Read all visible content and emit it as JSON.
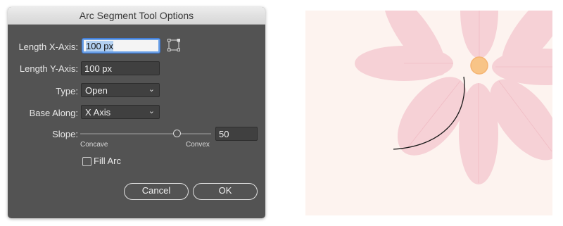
{
  "dialog": {
    "title": "Arc Segment Tool Options",
    "length_x_label": "Length X-Axis:",
    "length_x_value": "100 px",
    "length_y_label": "Length Y-Axis:",
    "length_y_value": "100 px",
    "type_label": "Type:",
    "type_value": "Open",
    "base_along_label": "Base Along:",
    "base_along_value": "X Axis",
    "slope_label": "Slope:",
    "slope_value": "50",
    "slope_min_label": "Concave",
    "slope_max_label": "Convex",
    "slope_fraction": 0.5,
    "fill_arc_label": "Fill Arc",
    "fill_arc_checked": false,
    "cancel_label": "Cancel",
    "ok_label": "OK"
  },
  "artwork": {
    "background_color": "#fdf3ef",
    "petal_color": "#f6d1d6",
    "vein_color": "#f0bcc4",
    "center_color": "#f8c487",
    "arc_color": "#1a1a1a"
  }
}
